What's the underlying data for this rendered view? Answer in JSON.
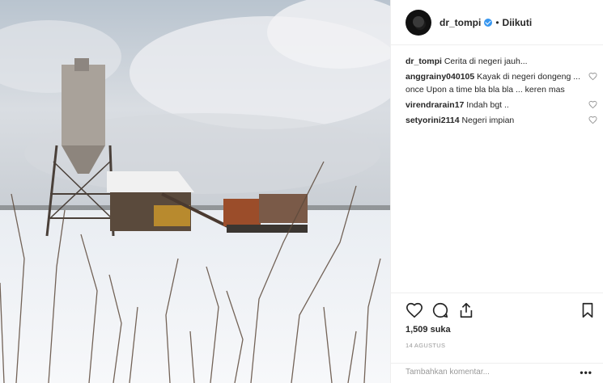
{
  "post": {
    "author": "dr_tompi",
    "follow_separator": "•",
    "follow_status": "Diikuti",
    "likes": "1,509 suka",
    "date": "14 AGUSTUS",
    "comment_placeholder": "Tambahkan komentar...",
    "more": "•••"
  },
  "caption": {
    "user": "dr_tompi",
    "text": "Cerita di negeri jauh..."
  },
  "comments": [
    {
      "user": "anggrainy040105",
      "text": "Kayak di negeri dongeng ... once Upon a time bla bla bla ... keren mas"
    },
    {
      "user": "virendrarain17",
      "text": "Indah bgt .."
    },
    {
      "user": "setyorini2114",
      "text": "Negeri impian"
    }
  ],
  "icons": [
    "verified-icon",
    "heart-icon",
    "comment-icon",
    "share-icon",
    "bookmark-icon"
  ],
  "colors": {
    "verified": "#3897f0",
    "border": "#efefef",
    "muted": "#999999"
  }
}
